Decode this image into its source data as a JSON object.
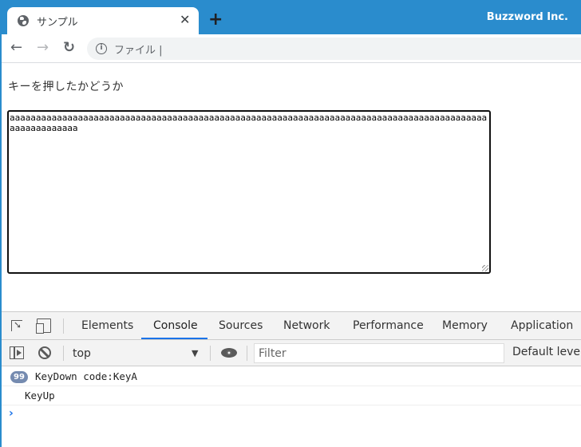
{
  "browser": {
    "tab_title": "サンプル",
    "tab_icon": "globe-icon",
    "close_glyph": "✕",
    "newtab_glyph": "+",
    "brand": "Buzzword Inc.",
    "accent_color": "#2a8ccd",
    "nav": {
      "back": "←",
      "forward": "→",
      "reload": "↻"
    },
    "omnibox": {
      "info_glyph": "i",
      "text": "ファイル |"
    }
  },
  "page": {
    "heading": "キーを押したかどうか",
    "textarea_value": "aaaaaaaaaaaaaaaaaaaaaaaaaaaaaaaaaaaaaaaaaaaaaaaaaaaaaaaaaaaaaaaaaaaaaaaaaaaaaaaaaaaaaaaaaaaaaaaaaaaaaaaa"
  },
  "devtools": {
    "tabs": [
      {
        "label": "Elements",
        "active": false
      },
      {
        "label": "Console",
        "active": true
      },
      {
        "label": "Sources",
        "active": false
      },
      {
        "label": "Network",
        "active": false
      },
      {
        "label": "Performance",
        "active": false
      },
      {
        "label": "Memory",
        "active": false
      },
      {
        "label": "Application",
        "active": false
      }
    ],
    "context": "top",
    "context_arrow": "▼",
    "filter_placeholder": "Filter",
    "levels_label": "Default levels",
    "logs": [
      {
        "count": "99",
        "text": "KeyDown code:KeyA"
      },
      {
        "count": "",
        "text": "KeyUp"
      }
    ],
    "prompt_glyph": "›"
  }
}
